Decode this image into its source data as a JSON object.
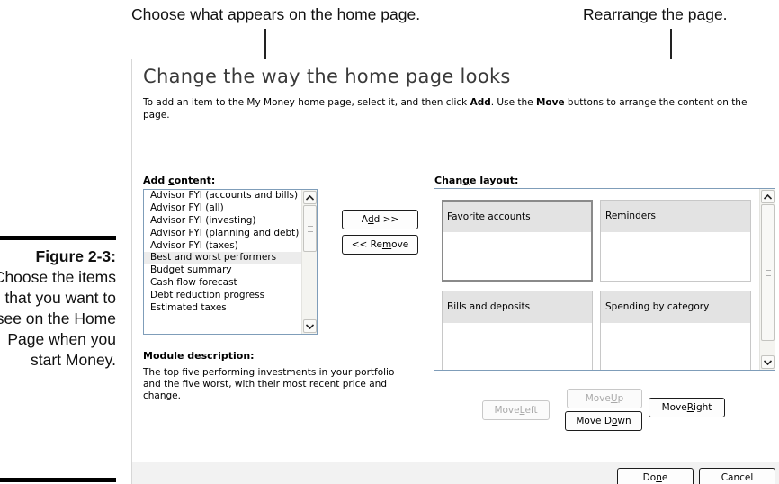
{
  "callouts": {
    "left": "Choose what appears on the home page.",
    "right": "Rearrange the page."
  },
  "figure": {
    "label": "Figure 2-3:",
    "caption": "Choose the items that you want to see on the Home Page when you start Money."
  },
  "dialog": {
    "title": "Change the way the home page looks",
    "instructions": {
      "part1": "To add an item to the My Money home page, select it, and then click ",
      "add_word": "Add",
      "part2": ". Use the ",
      "move_word": "Move",
      "part3": " buttons to arrange the content on the page."
    },
    "add_content": {
      "label_pre": "Add ",
      "label_key": "c",
      "label_post": "ontent:",
      "items": [
        "Advisor FYI (accounts and bills)",
        "Advisor FYI (all)",
        "Advisor FYI (investing)",
        "Advisor FYI (planning and debt)",
        "Advisor FYI (taxes)",
        "Best and worst performers",
        "Budget summary",
        "Cash flow forecast",
        "Debt reduction progress",
        "Estimated taxes"
      ],
      "selected_index": 5
    },
    "buttons": {
      "add": {
        "pre": "A",
        "key": "d",
        "post": "d >>"
      },
      "remove": {
        "pre": "<< Re",
        "key": "m",
        "post": "ove"
      },
      "move_left": {
        "pre": "Move ",
        "key": "L",
        "post": "eft"
      },
      "move_up": {
        "pre": "Move ",
        "key": "U",
        "post": "p"
      },
      "move_down": {
        "pre": "Move D",
        "key": "o",
        "post": "wn"
      },
      "move_right": {
        "pre": "Move ",
        "key": "R",
        "post": "ight"
      },
      "done": {
        "pre": "Do",
        "key": "n",
        "post": "e"
      },
      "cancel": "Cancel"
    },
    "module_description": {
      "label": "Module description:",
      "text": "The top five performing investments in your portfolio and the five worst, with their most recent price and change."
    },
    "change_layout": {
      "label_pre": "Chan",
      "label_key": "g",
      "label_post": "e layout:",
      "tiles": [
        "Favorite accounts",
        "Reminders",
        "Bills and deposits",
        "Spending by category"
      ],
      "selected_tile": 0
    }
  },
  "colors": {
    "listbox_border": "#7f9db9",
    "tile_header": "#e3e3e3",
    "disabled_text": "#a9a9a9"
  }
}
